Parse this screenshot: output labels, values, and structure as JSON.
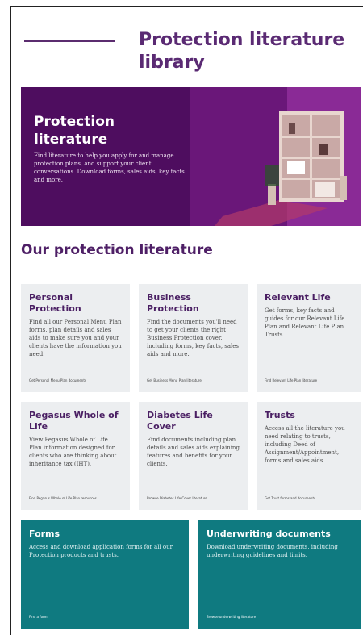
{
  "header": {
    "title": "Protection literature library"
  },
  "hero": {
    "title": "Protection literature",
    "description": "Find literature to help you apply for and manage protection plans, and support your client conversations. Download forms, sales aids, key facts and more."
  },
  "section": {
    "title": "Our protection literature"
  },
  "cards": [
    {
      "title": "Personal Protection",
      "description": "Find all our Personal Menu Plan forms, plan details and sales aids to make sure you and your clients have the information you need.",
      "link": "Get Personal Menu Plan documents"
    },
    {
      "title": "Business Protection",
      "description": "Find the documents you'll need to get your clients the right Business Protection cover, including forms, key facts, sales aids and more.",
      "link": "Get Business Menu Plan literature"
    },
    {
      "title": "Relevant Life",
      "description": "Get forms, key facts and guides for our Relevant Life Plan and Relevant Life Plan Trusts.",
      "link": "Find Relevant Life Plan literature"
    },
    {
      "title": "Pegasus Whole of Life",
      "description": "View Pegasus Whole of Life Plan information designed for clients who are thinking about inheritance tax (IHT).",
      "link": "Find Pegasus Whole of Life Plan resources"
    },
    {
      "title": "Diabetes Life Cover",
      "description": "Find documents including plan details and sales aids explaining features and benefits for your clients.",
      "link": "Browse Diabetes Life Cover literature"
    },
    {
      "title": "Trusts",
      "description": "Access all the literature you need relating to trusts, including Deed of Assignment/Appointment, forms and sales aids.",
      "link": "Get Trust forms and documents"
    }
  ],
  "wide_cards": [
    {
      "title": "Forms",
      "description": "Access and download application forms for all our Protection products and trusts.",
      "link": "Find a form"
    },
    {
      "title": "Underwriting documents",
      "description": "Download underwriting documents, including underwriting guidelines and limits.",
      "link": "Browse underwriting literature"
    }
  ],
  "colors": {
    "purple": "#5a2a73",
    "teal": "#0f7a80",
    "card_bg": "#eceef0"
  }
}
